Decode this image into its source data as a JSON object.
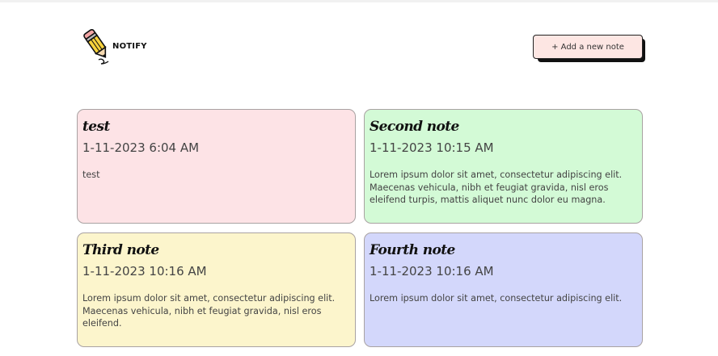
{
  "app": {
    "brand_name": "NOTIFY",
    "logo_icon": "pencil-icon"
  },
  "toolbar": {
    "add_label": "+ Add a new note"
  },
  "notes": [
    {
      "title": "test",
      "date": "1-11-2023 6:04 AM",
      "body": "test",
      "color": "#fde3e6"
    },
    {
      "title": "Second note",
      "date": "1-11-2023 10:15 AM",
      "body": "Lorem ipsum dolor sit amet, consectetur adipiscing elit. Maecenas vehicula, nibh et feugiat gravida, nisl eros eleifend turpis, mattis aliquet nunc dolor eu magna.",
      "color": "#d3fad6"
    },
    {
      "title": "Third note",
      "date": "1-11-2023 10:16 AM",
      "body": "Lorem ipsum dolor sit amet, consectetur adipiscing elit. Maecenas vehicula, nibh et feugiat gravida, nisl eros eleifend.",
      "color": "#fcf5cc"
    },
    {
      "title": "Fourth note",
      "date": "1-11-2023 10:16 AM",
      "body": "Lorem ipsum dolor sit amet, consectetur adipiscing elit.",
      "color": "#d3d7fb"
    }
  ]
}
